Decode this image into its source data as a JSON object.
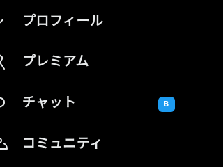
{
  "menu": {
    "items": [
      {
        "label": "プロフィール",
        "icon": "profile-icon"
      },
      {
        "label": "プレミアム",
        "icon": "premium-icon"
      },
      {
        "label": "チャット",
        "icon": "chat-icon",
        "badge": "B"
      },
      {
        "label": "コミュニティ",
        "icon": "communities-icon"
      }
    ]
  },
  "colors": {
    "background": "#000000",
    "text": "#e7e9ea",
    "badge": "#1d9bf0"
  }
}
